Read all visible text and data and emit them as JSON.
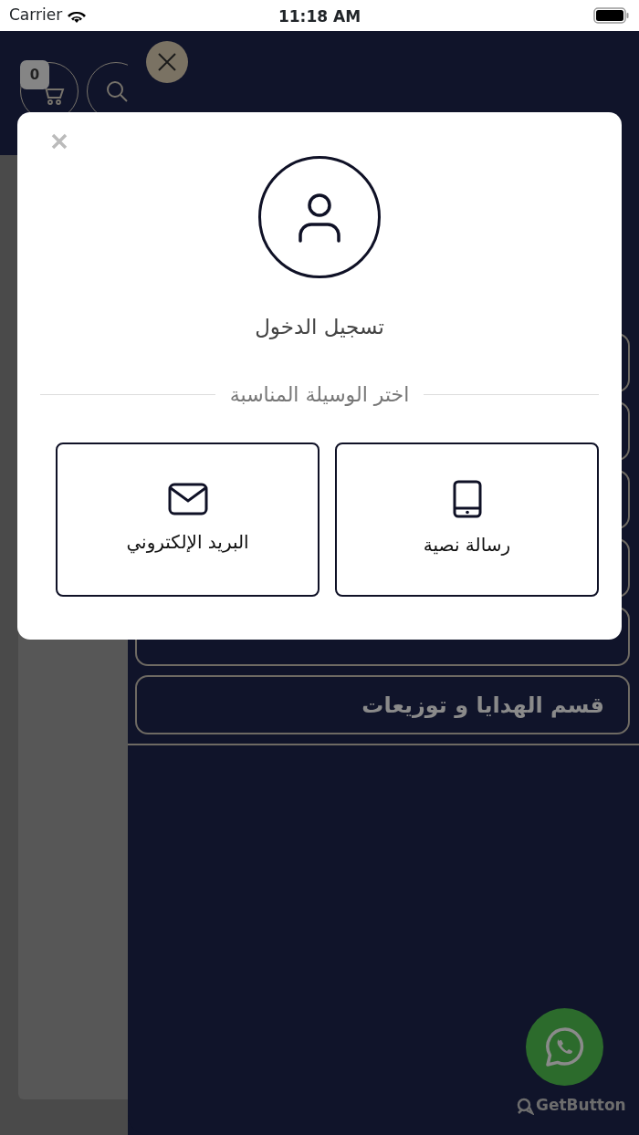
{
  "status_bar": {
    "carrier": "Carrier",
    "time": "11:18 AM"
  },
  "header": {
    "cart_count": "0"
  },
  "drawer": {
    "items": [
      {
        "kind": "covered"
      },
      {
        "kind": "covered"
      },
      {
        "kind": "covered"
      },
      {
        "kind": "covered"
      },
      {
        "kind": "covered"
      },
      {
        "kind": "text",
        "label": "قسم الهدايا و توزيعات"
      }
    ]
  },
  "modal": {
    "title": "تسجيل الدخول",
    "divider_text": "اختر الوسيلة المناسبة",
    "options": [
      {
        "kind": "sms",
        "label": "رسالة نصية"
      },
      {
        "kind": "email",
        "label": "البريد الإلكتروني"
      }
    ]
  },
  "chat_widget": {
    "brand": "GetButton"
  }
}
